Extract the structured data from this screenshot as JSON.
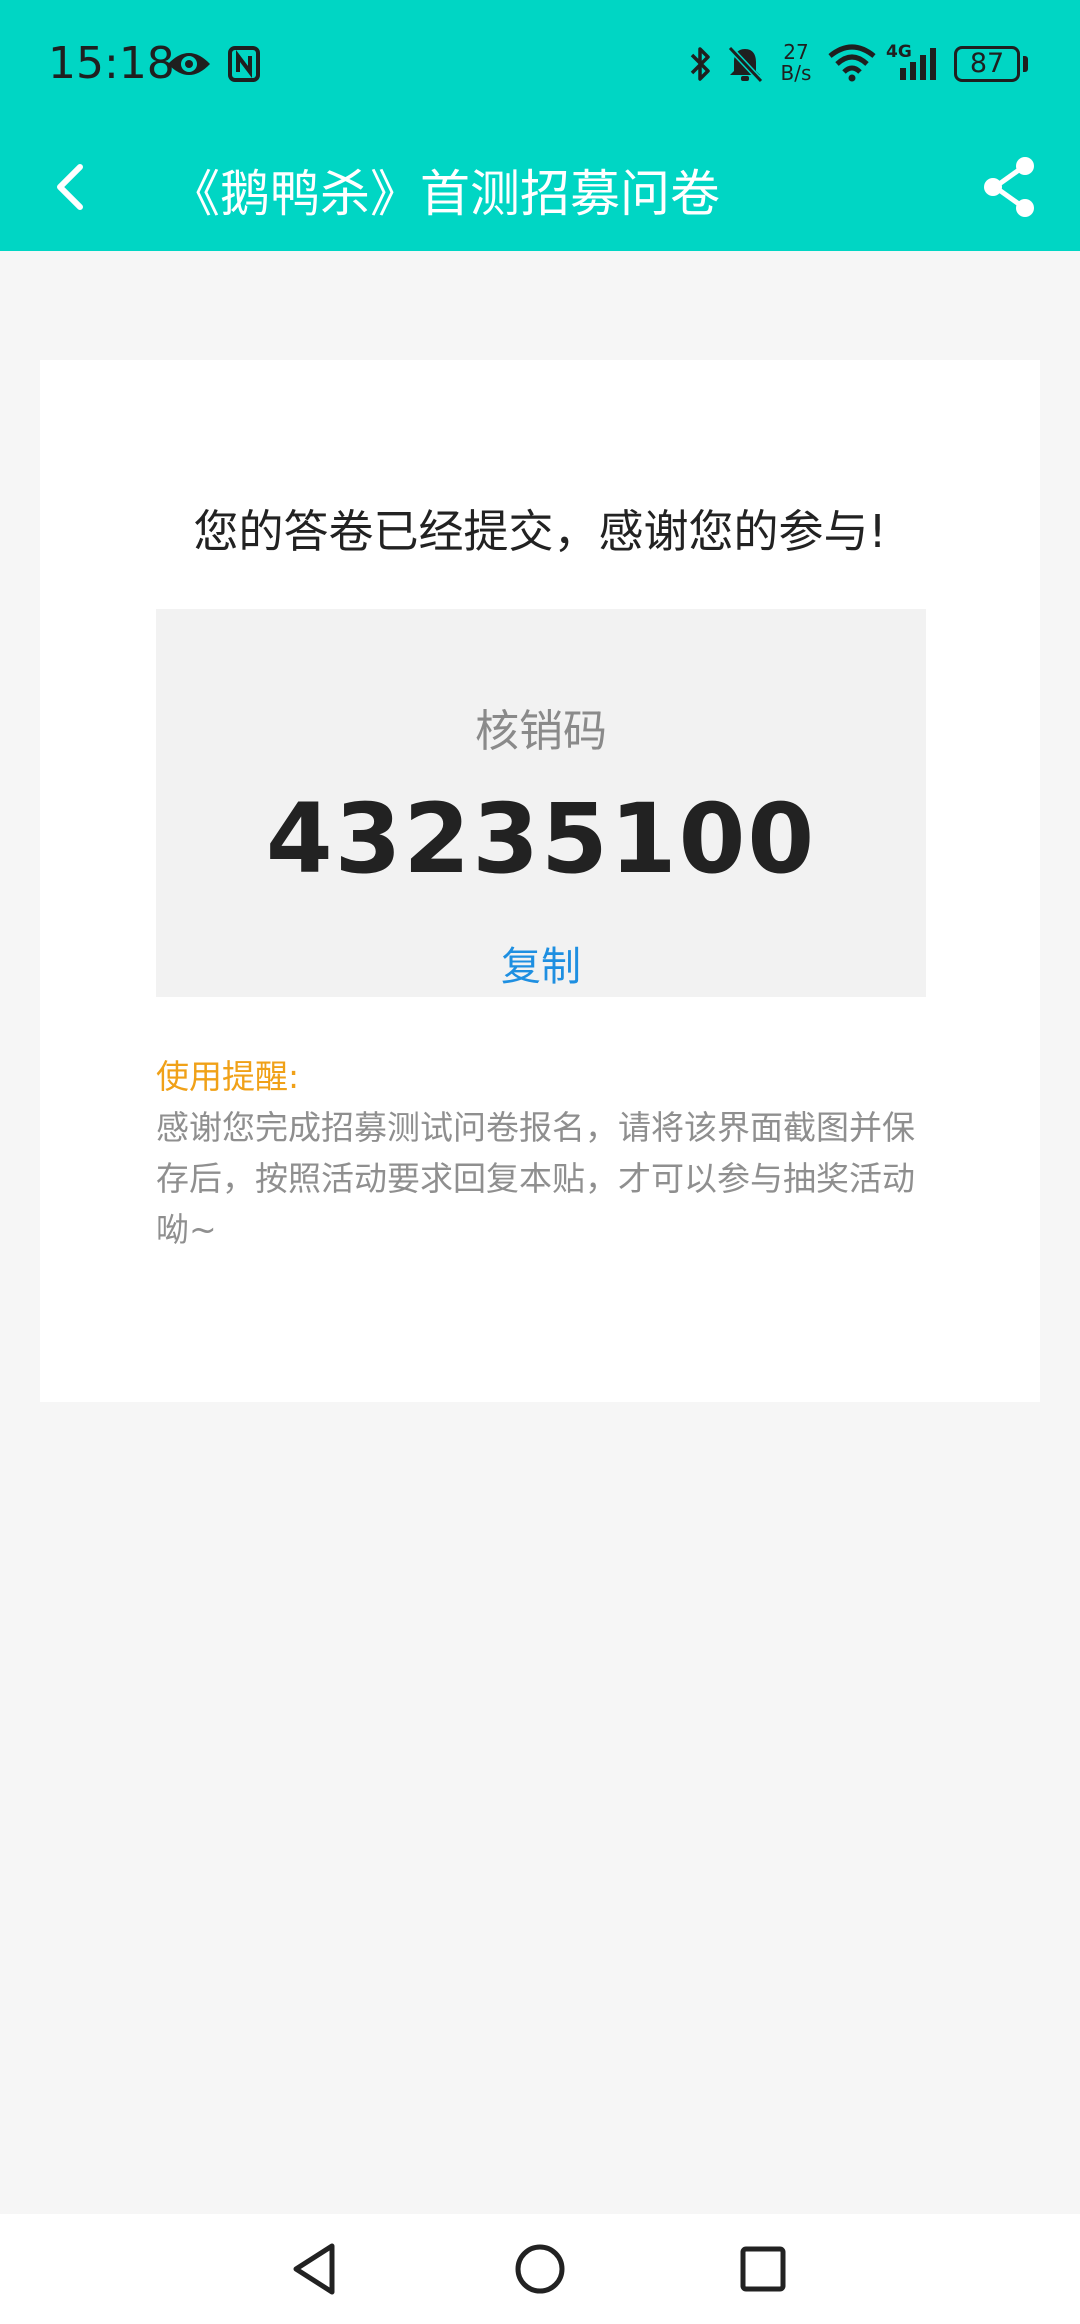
{
  "status_bar": {
    "time": "15:18",
    "net_speed_value": "27",
    "net_speed_unit": "B/s",
    "network_type": "4G",
    "battery": "87"
  },
  "header": {
    "title": "《鹅鸭杀》首测招募问卷",
    "background_color": "#00d6c4"
  },
  "card": {
    "heading": "您的答卷已经提交，感谢您的参与!",
    "code_label": "核销码",
    "code_value": "43235100",
    "copy_label": "复制",
    "tip_title": "使用提醒:",
    "tip_text": "感谢您完成招募测试问卷报名，请将该界面截图并保存后，按照活动要求回复本贴，才可以参与抽奖活动呦~"
  },
  "colors": {
    "accent_link": "#1e8fe1",
    "tip_title": "#f0a118"
  }
}
